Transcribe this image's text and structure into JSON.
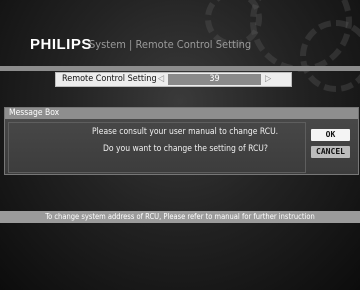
{
  "header": {
    "brand": "PHILIPS",
    "breadcrumb": "System | Remote Control Setting"
  },
  "setting": {
    "label": "Remote Control Setting",
    "value": "39",
    "left_arrow": "◁",
    "right_arrow": "▷"
  },
  "message_box": {
    "title": "Message Box",
    "line1": "Please consult your user manual to change RCU.",
    "line2": "Do you want to change the setting of RCU?",
    "ok_label": "OK",
    "cancel_label": "CANCEL"
  },
  "footer": {
    "hint": "To change system address of RCU, Please refer to manual for further instruction"
  },
  "colors": {
    "bar": "#9b9b9b",
    "ok_button": "#f4f4f4",
    "cancel_button": "#bcbcbc"
  }
}
